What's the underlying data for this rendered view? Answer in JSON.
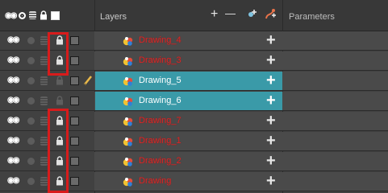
{
  "header": {
    "layers_label": "Layers",
    "parameters_label": "Parameters",
    "add_icon": "+",
    "remove_icon": "—"
  },
  "layers": [
    {
      "name": "Drawing_4",
      "locked": true,
      "selected": false
    },
    {
      "name": "Drawing_3",
      "locked": true,
      "selected": false
    },
    {
      "name": "Drawing_5",
      "locked": false,
      "selected": true,
      "current": true
    },
    {
      "name": "Drawing_6",
      "locked": false,
      "selected": true
    },
    {
      "name": "Drawing_7",
      "locked": true,
      "selected": false
    },
    {
      "name": "Drawing_1",
      "locked": true,
      "selected": false
    },
    {
      "name": "Drawing_2",
      "locked": true,
      "selected": false
    },
    {
      "name": "Drawing",
      "locked": true,
      "selected": false
    }
  ],
  "colors": {
    "locked_label": "#d22a2a",
    "selected_row": "#3a9aa8",
    "highlight": "#d81b1b"
  },
  "icons": {
    "visibility": "eye-icon",
    "sound": "sound-icon",
    "stack": "stack-icon",
    "lock": "lock-icon",
    "color_swatch": "color-swatch-icon",
    "current_layer": "pencil-icon",
    "drawing_layer": "drawing-layer-icon"
  }
}
